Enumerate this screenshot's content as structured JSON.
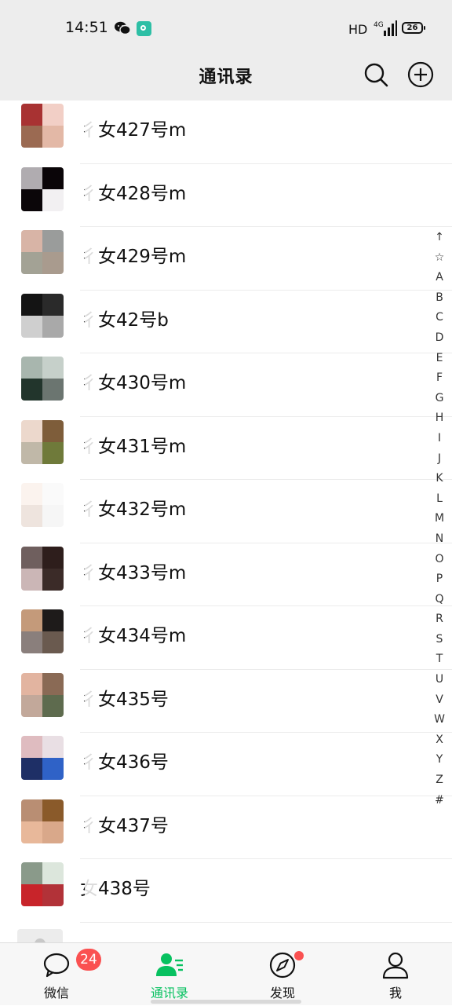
{
  "status_bar": {
    "time": "14:51",
    "network": "HD",
    "signal": "4G",
    "battery": "26"
  },
  "header": {
    "title": "通讯录"
  },
  "contacts": [
    {
      "name": "女427号m",
      "prefix": "彳",
      "avatar": [
        "#a83232",
        "#f2cfc6",
        "#9b6a52",
        "#e3b8a6"
      ]
    },
    {
      "name": "女428号m",
      "prefix": "彳",
      "avatar": [
        "#b0acb0",
        "#0a0508",
        "#0b0609",
        "#f2f0f2"
      ]
    },
    {
      "name": "女429号m",
      "prefix": "彳",
      "avatar": [
        "#d8b4a6",
        "#9a9c9b",
        "#a3a295",
        "#a99b8e"
      ]
    },
    {
      "name": "女42号b",
      "prefix": "彳",
      "avatar": [
        "#141414",
        "#2a2a2a",
        "#cfcfcf",
        "#a9a9a9"
      ]
    },
    {
      "name": "女430号m",
      "prefix": "彳",
      "avatar": [
        "#a8b6ae",
        "#c6d0ca",
        "#22352c",
        "#6b7570"
      ]
    },
    {
      "name": "女431号m",
      "prefix": "彳",
      "avatar": [
        "#ecd8cc",
        "#7e5d3a",
        "#c0b8a8",
        "#6f7a3a"
      ]
    },
    {
      "name": "女432号m",
      "prefix": "彳",
      "avatar": [
        "#fbf3ee",
        "#fafafa",
        "#eee4de",
        "#f6f6f6"
      ]
    },
    {
      "name": "女433号m",
      "prefix": "彳",
      "avatar": [
        "#6f5f5e",
        "#2e1e1c",
        "#cbb6b6",
        "#3b2b28"
      ]
    },
    {
      "name": "女434号m",
      "prefix": "彳",
      "avatar": [
        "#c49a7a",
        "#1e1b1a",
        "#8a7f7c",
        "#6a5a4f"
      ]
    },
    {
      "name": "女435号",
      "prefix": "彳",
      "avatar": [
        "#e2b4a0",
        "#8a6a55",
        "#c2a89a",
        "#5e6b4e"
      ]
    },
    {
      "name": "女436号",
      "prefix": "彳",
      "avatar": [
        "#dfbcc0",
        "#e9dfe4",
        "#1e2f66",
        "#2f62c7"
      ]
    },
    {
      "name": "女437号",
      "prefix": "彳",
      "avatar": [
        "#b98e73",
        "#8a5a2a",
        "#e8b89a",
        "#d9a88a"
      ]
    },
    {
      "name": "女438号",
      "prefix": "",
      "avatar": [
        "#8a9a8a",
        "#dce6dc",
        "#c8242a",
        "#b23238"
      ]
    }
  ],
  "alpha_index": [
    "↑",
    "☆",
    "A",
    "B",
    "C",
    "D",
    "E",
    "F",
    "G",
    "H",
    "I",
    "J",
    "K",
    "L",
    "M",
    "N",
    "O",
    "P",
    "Q",
    "R",
    "S",
    "T",
    "U",
    "V",
    "W",
    "X",
    "Y",
    "Z",
    "#"
  ],
  "tabs": [
    {
      "label": "微信",
      "badge": "24"
    },
    {
      "label": "通讯录"
    },
    {
      "label": "发现"
    },
    {
      "label": "我"
    }
  ],
  "colors": {
    "accent": "#07c160",
    "badge": "#fa5151",
    "bar_bg": "#ededed"
  }
}
